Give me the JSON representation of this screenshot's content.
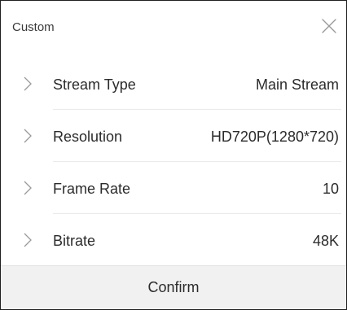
{
  "dialog": {
    "title": "Custom",
    "close_icon": "close-icon"
  },
  "settings": [
    {
      "label": "Stream Type",
      "value": "Main Stream",
      "icon": "chevron-right-icon"
    },
    {
      "label": "Resolution",
      "value": "HD720P(1280*720)",
      "icon": "chevron-right-icon"
    },
    {
      "label": "Frame Rate",
      "value": "10",
      "icon": "chevron-right-icon"
    },
    {
      "label": "Bitrate",
      "value": "48K",
      "icon": "chevron-right-icon"
    }
  ],
  "footer": {
    "confirm_label": "Confirm"
  },
  "colors": {
    "divider": "#ebebeb",
    "footer_bg": "#f1f1f1",
    "icon": "#9a9a9a"
  }
}
